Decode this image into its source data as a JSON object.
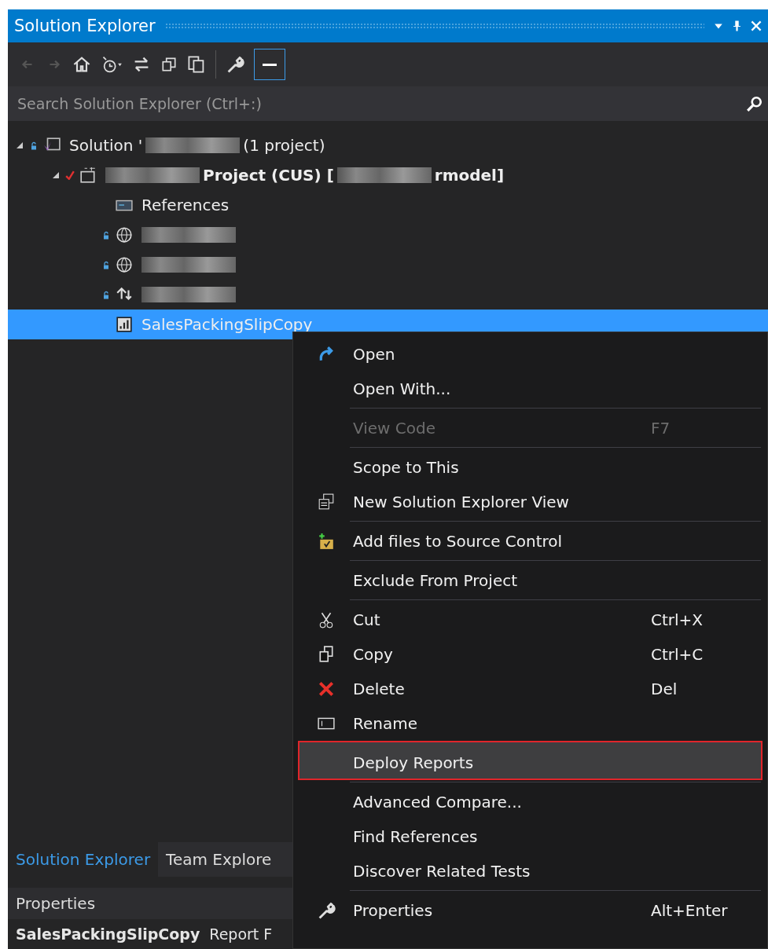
{
  "window": {
    "title": "Solution Explorer"
  },
  "search": {
    "placeholder": "Search Solution Explorer (Ctrl+:)"
  },
  "tree": [
    {
      "kind": "solution",
      "locked": true,
      "selected": false,
      "expanded": true,
      "parts": [
        {
          "kind": "text",
          "text": "Solution '"
        },
        {
          "kind": "redacted"
        },
        {
          "kind": "text",
          "text": "(1 project)"
        }
      ],
      "children": [
        {
          "kind": "project",
          "locked": false,
          "checked": true,
          "selected": false,
          "expanded": true,
          "bold": true,
          "parts": [
            {
              "kind": "redacted"
            },
            {
              "kind": "text",
              "text": "Project (CUS) ["
            },
            {
              "kind": "redacted"
            },
            {
              "kind": "text",
              "text": "rmodel]"
            }
          ],
          "children": [
            {
              "kind": "references",
              "locked": false,
              "selected": false,
              "parts": [
                {
                  "kind": "text",
                  "text": "References"
                }
              ]
            },
            {
              "kind": "globe",
              "locked": true,
              "selected": false,
              "parts": [
                {
                  "kind": "redacted"
                }
              ]
            },
            {
              "kind": "globe",
              "locked": true,
              "selected": false,
              "parts": [
                {
                  "kind": "redacted"
                }
              ]
            },
            {
              "kind": "flow",
              "locked": true,
              "selected": false,
              "parts": [
                {
                  "kind": "redacted"
                }
              ]
            },
            {
              "kind": "report",
              "locked": false,
              "selected": true,
              "parts": [
                {
                  "kind": "text",
                  "text": "SalesPackingSlipCopy"
                }
              ]
            }
          ]
        }
      ]
    }
  ],
  "bottom_tabs": [
    {
      "label": "Solution Explorer",
      "selected": true
    },
    {
      "label": "Team Explore",
      "selected": false
    }
  ],
  "properties": {
    "title": "Properties",
    "object_name": "SalesPackingSlipCopy",
    "object_type": "Report F"
  },
  "context_menu": [
    {
      "label": "Open",
      "disabled": false,
      "highlighted": false,
      "separator_before": false
    },
    {
      "label": "Open With...",
      "disabled": false,
      "highlighted": false,
      "separator_before": false
    },
    {
      "label": "View Code",
      "shortcut": "F7",
      "disabled": true,
      "highlighted": false,
      "separator_before": true
    },
    {
      "label": "Scope to This",
      "disabled": false,
      "highlighted": false,
      "separator_before": true
    },
    {
      "label": "New Solution Explorer View",
      "disabled": false,
      "highlighted": false,
      "separator_before": false
    },
    {
      "label": "Add files to Source Control",
      "disabled": false,
      "highlighted": false,
      "separator_before": true
    },
    {
      "label": "Exclude From Project",
      "disabled": false,
      "highlighted": false,
      "separator_before": true
    },
    {
      "label": "Cut",
      "shortcut": "Ctrl+X",
      "disabled": false,
      "highlighted": false,
      "separator_before": true
    },
    {
      "label": "Copy",
      "shortcut": "Ctrl+C",
      "disabled": false,
      "highlighted": false,
      "separator_before": false
    },
    {
      "label": "Delete",
      "shortcut": "Del",
      "disabled": false,
      "highlighted": false,
      "separator_before": false
    },
    {
      "label": "Rename",
      "disabled": false,
      "highlighted": false,
      "separator_before": false
    },
    {
      "label": "Deploy Reports",
      "disabled": false,
      "highlighted": true,
      "separator_before": true
    },
    {
      "label": "Advanced Compare...",
      "disabled": false,
      "highlighted": false,
      "separator_before": true
    },
    {
      "label": "Find References",
      "disabled": false,
      "highlighted": false,
      "separator_before": false
    },
    {
      "label": "Discover Related Tests",
      "disabled": false,
      "highlighted": false,
      "separator_before": false
    },
    {
      "label": "Properties",
      "shortcut": "Alt+Enter",
      "disabled": false,
      "highlighted": false,
      "separator_before": true
    }
  ]
}
